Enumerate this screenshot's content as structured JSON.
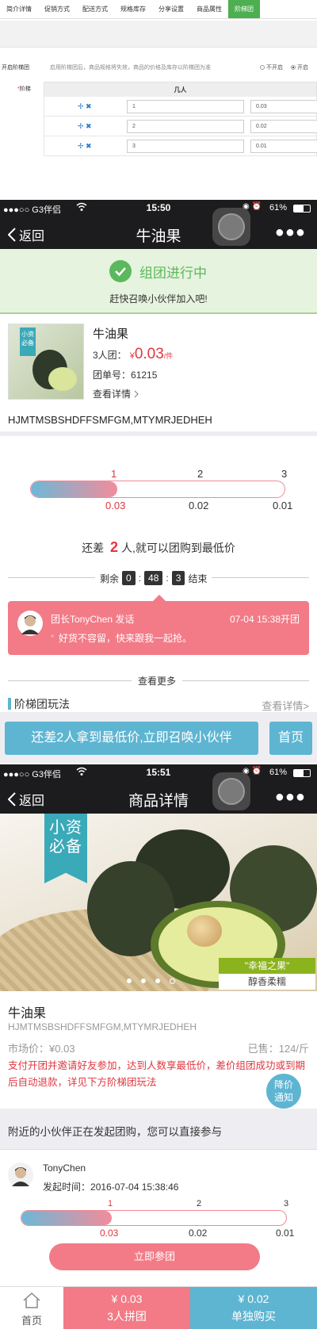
{
  "admin": {
    "tabs": [
      "简介详情",
      "促销方式",
      "配送方式",
      "规格库存",
      "分享设置",
      "商品属性",
      "阶梯团"
    ],
    "active_tab": 6,
    "enable_label": "开启阶梯团",
    "enable_hint": "启用阶梯团后，商品规格将失效，商品的价格及库存以阶梯团为准",
    "radio_off": "不开启",
    "radio_on": "开启",
    "ladder_label": "阶梯",
    "ladder_label_star": "*",
    "ladder_header": "几人",
    "ops": "✢ ✖",
    "rows": [
      {
        "people": "1",
        "price": "0.03"
      },
      {
        "people": "2",
        "price": "0.02"
      },
      {
        "people": "3",
        "price": "0.01"
      }
    ]
  },
  "screen1": {
    "status": {
      "carrier": "●●●○○ G3伴侣",
      "wifi": "wifi-icon",
      "time": "15:50",
      "battery": "61%"
    },
    "nav": {
      "back": "返回",
      "title": "牛油果",
      "more": "●●●"
    },
    "banner": {
      "title": "组团进行中",
      "subtitle": "赶快召唤小伙伴加入吧!"
    },
    "product": {
      "name": "牛油果",
      "group_label": "3人团：",
      "currency": "¥",
      "price": "0.03",
      "unit": "/件",
      "order_label": "团单号：",
      "order_no": "61215",
      "detail_link": "查看详情",
      "desc": "HJMTMSBSHDFFSMFGM,MTYMRJEDHEH",
      "thumb_text": "小资必备"
    },
    "progress": {
      "counts": [
        "1",
        "2",
        "3"
      ],
      "prices": [
        "0.03",
        "0.02",
        "0.01"
      ],
      "fill_fraction": 0.34
    },
    "remain": {
      "prefix": "还差",
      "count": "2",
      "suffix": "人,就可以团购到最低价"
    },
    "countdown": {
      "prefix": "剩余",
      "h": "0",
      "m": "48",
      "s": "3",
      "suffix": "结束"
    },
    "message": {
      "who": "团长TonyChen 发话",
      "time": "07-04 15:38开团",
      "text": "好货不容留，快来跟我一起抢。"
    },
    "more": "查看更多",
    "rules": {
      "title": "阶梯团玩法",
      "link": "查看详情>"
    },
    "action": {
      "invite": "还差2人拿到最低价,立即召唤小伙伴",
      "home": "首页"
    }
  },
  "screen2": {
    "status": {
      "carrier": "●●●○○ G3伴侣",
      "wifi": "wifi-icon",
      "time": "15:51",
      "battery": "61%"
    },
    "nav": {
      "back": "返回",
      "title": "商品详情",
      "more": "●●●"
    },
    "hero": {
      "tag": "小资必备",
      "brand": "\"幸福之果\"",
      "brand_sub": "醇香柔糯"
    },
    "product": {
      "name": "牛油果",
      "desc": "HJMTMSBSHDFFSMFGM,MTYMRJEDHEH",
      "market_label": "市场价：",
      "market_price": "¥0.03",
      "sold_label": "已售：",
      "sold": "124/斤",
      "notice": "支付开团并邀请好友参加，达到人数享最低价，差价组团成功或到期后自动退款，详见下方阶梯团玩法",
      "drop_btn": "降价通知"
    },
    "nearby": {
      "title": "附近的小伙伴正在发起团购，您可以直接参与"
    },
    "group": {
      "leader": "TonyChen",
      "start_label": "发起时间：",
      "start_time": "2016-07-04 15:38:46",
      "counts": [
        "1",
        "2",
        "3"
      ],
      "prices": [
        "0.03",
        "0.02",
        "0.01"
      ],
      "fill_fraction": 0.34,
      "join": "立即参团"
    },
    "tabbar": {
      "home": "首页",
      "group_price": "¥ 0.03",
      "group_label": "3人拼团",
      "single_price": "¥ 0.02",
      "single_label": "单独购买"
    }
  },
  "colors": {
    "accent_green": "#4caf50",
    "pink": "#f27b87",
    "blue": "#5eb5d2",
    "red": "#e0373f"
  }
}
